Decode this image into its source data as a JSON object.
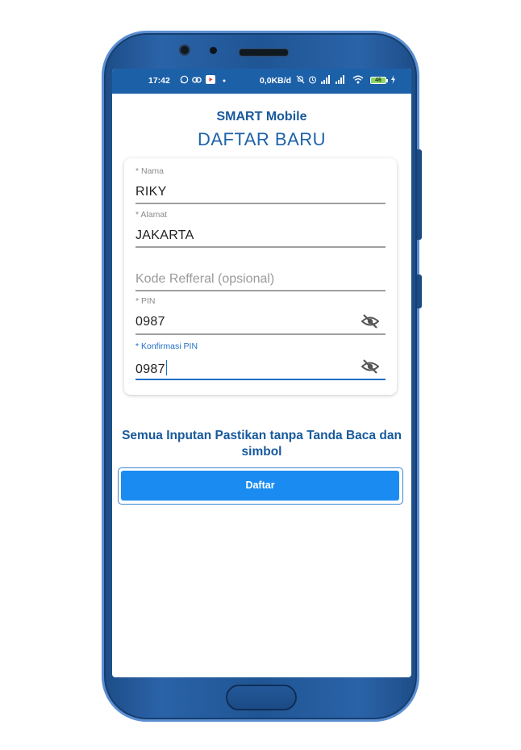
{
  "statusbar": {
    "time": "17:42",
    "icons_left": [
      "whatsapp-icon",
      "link-icon",
      "youtube-icon",
      "dot-icon"
    ],
    "network_rate": "0,0KB/d",
    "icons_right": [
      "mute-icon",
      "alarm-icon",
      "signal-icon",
      "signal-icon",
      "wifi-icon"
    ],
    "battery": "46"
  },
  "header": {
    "app_name": "SMART Mobile",
    "page_title": "DAFTAR BARU"
  },
  "form": {
    "nama": {
      "label": "* Nama",
      "value": "RIKY"
    },
    "alamat": {
      "label": "* Alamat",
      "value": "JAKARTA"
    },
    "referral": {
      "placeholder": "Kode Refferal (opsional)",
      "value": ""
    },
    "pin": {
      "label": "* PIN",
      "value": "0987"
    },
    "konfirmasi_pin": {
      "label": "* Konfirmasi PIN",
      "value": "0987"
    }
  },
  "notice": "Semua Inputan Pastikan tanpa Tanda Baca dan simbol",
  "submit_label": "Daftar",
  "colors": {
    "primary": "#1c60a8",
    "button": "#1a8cf1",
    "accent_active": "#1f6fc5",
    "phone_body": "#1f5594"
  }
}
